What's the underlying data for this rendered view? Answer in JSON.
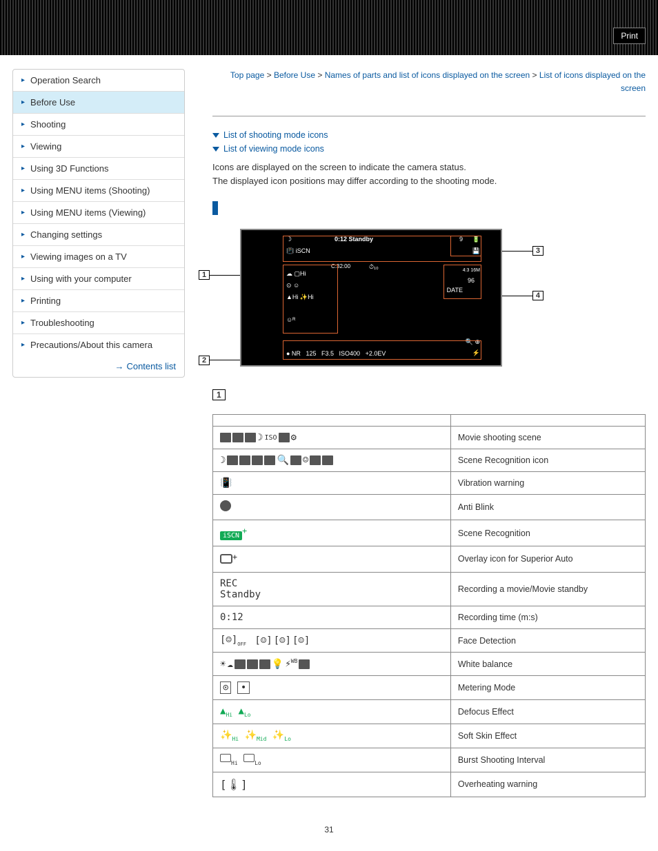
{
  "header": {
    "print": "Print"
  },
  "sidebar": {
    "items": [
      {
        "label": "Operation Search"
      },
      {
        "label": "Before Use"
      },
      {
        "label": "Shooting"
      },
      {
        "label": "Viewing"
      },
      {
        "label": "Using 3D Functions"
      },
      {
        "label": "Using MENU items (Shooting)"
      },
      {
        "label": "Using MENU items (Viewing)"
      },
      {
        "label": "Changing settings"
      },
      {
        "label": "Viewing images on a TV"
      },
      {
        "label": "Using with your computer"
      },
      {
        "label": "Printing"
      },
      {
        "label": "Troubleshooting"
      },
      {
        "label": "Precautions/About this camera"
      }
    ],
    "contents_list": "Contents list"
  },
  "breadcrumb": {
    "top": "Top page",
    "before_use": "Before Use",
    "names": "Names of parts and list of icons displayed on the screen",
    "current": "List of icons displayed on the screen",
    "sep": " > "
  },
  "links": {
    "shooting_icons": "List of shooting mode icons",
    "viewing_icons": "List of viewing mode icons"
  },
  "description": {
    "line1": "Icons are displayed on the screen to indicate the camera status.",
    "line2": "The displayed icon positions may differ according to the shooting mode."
  },
  "screenshot": {
    "standby": "Standby",
    "time": "0:12",
    "cval": "C:32:00",
    "shutter": "125",
    "fnum": "F3.5",
    "iso": "ISO400",
    "ev": "+2.0EV",
    "count9": "9",
    "count96": "96",
    "labels": {
      "1": "1",
      "2": "2",
      "3": "3",
      "4": "4"
    }
  },
  "section_num": "1",
  "table": {
    "rows": [
      {
        "icon_text": "iAUTO P A S M ISO SCN ⊕",
        "meaning": "Movie shooting scene"
      },
      {
        "icon_text": "☽ ▲ 🌄 🌆 ▲ ✕ 🔍 ☺ 🖐 🐾 🍴 ☀",
        "meaning": "Scene Recognition icon"
      },
      {
        "icon_text": "📳",
        "meaning": "Vibration warning"
      },
      {
        "icon_text": "👁",
        "meaning": "Anti Blink"
      },
      {
        "icon_text": "iSCN+",
        "meaning": "Scene Recognition"
      },
      {
        "icon_text": "▢⁺",
        "meaning": "Overlay icon for Superior Auto"
      },
      {
        "icon_text": "REC\nStandby",
        "meaning": "Recording a movie/Movie standby"
      },
      {
        "icon_text": "0:12",
        "meaning": "Recording time (m:s)"
      },
      {
        "icon_text": "[☺]OFF [☺] [☺]",
        "meaning": "Face Detection"
      },
      {
        "icon_text": "☀ ☁ 💡 💡 💡 ☀ ⚡WB ▬",
        "meaning": "White balance"
      },
      {
        "icon_text": "[⊙] [•]",
        "meaning": "Metering Mode"
      },
      {
        "icon_text": "📷Hi 📷Lo",
        "meaning": "Defocus Effect"
      },
      {
        "icon_text": "✨Hi ✨Mid ✨Lo",
        "meaning": "Soft Skin Effect"
      },
      {
        "icon_text": "▢Hi ▢Lo",
        "meaning": "Burst Shooting Interval"
      },
      {
        "icon_text": "[🌡]",
        "meaning": "Overheating warning"
      }
    ]
  },
  "page_number": "31"
}
